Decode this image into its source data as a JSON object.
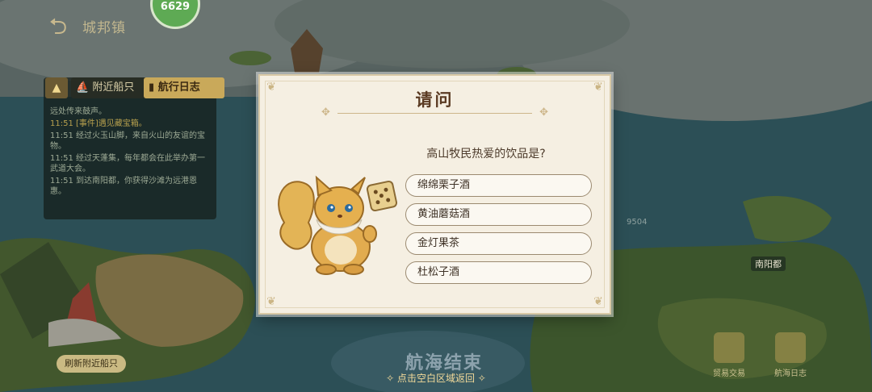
{
  "header": {
    "back_title": "城邦镇",
    "avatar_number": "6629"
  },
  "log": {
    "tab_nearby": "附近船只",
    "tab_journal": "航行日志",
    "lines": [
      {
        "text": "远处传来鼓声。",
        "highlight": false
      },
      {
        "text": "11:51 [事件]遇见藏宝箱。",
        "highlight": true
      },
      {
        "text": "11:51 经过火玉山脚，来自火山的友谊的宝物。",
        "highlight": false
      },
      {
        "text": "11:51 经过天蓬集，每年都会在此举办第一武道大会。",
        "highlight": false
      },
      {
        "text": "11:51 到达南阳都，你获得沙滩为远港恩惠。",
        "highlight": false
      }
    ]
  },
  "refresh_button": "刷新附近船只",
  "voyage_end": "航海结束",
  "tap_hint": "✧ 点击空白区域返回 ✧",
  "right_buttons": [
    {
      "label": "贸易交易"
    },
    {
      "label": "航海日志"
    }
  ],
  "city_label": "南阳都",
  "ship_count": "9504",
  "dialog": {
    "title": "请问",
    "question": "高山牧民热爱的饮品是?",
    "options": [
      {
        "label": "绵绵栗子酒"
      },
      {
        "label": "黄油蘑菇酒"
      },
      {
        "label": "金灯果茶"
      },
      {
        "label": "杜松子酒"
      }
    ]
  },
  "colors": {
    "accent_gold": "#c9a95a",
    "dialog_bg": "#f5efe2",
    "title_brown": "#5a3a22"
  }
}
